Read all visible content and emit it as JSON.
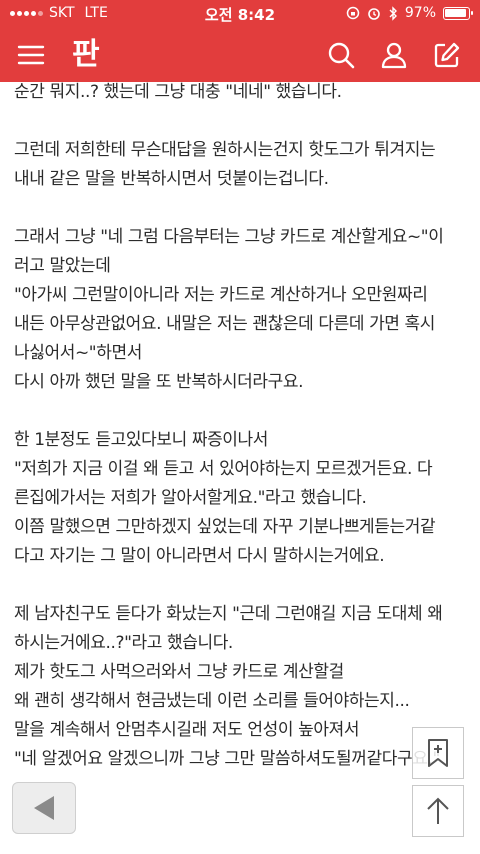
{
  "status_bar": {
    "carrier": "SKT",
    "network": "LTE",
    "time": "오전 8:42",
    "battery_pct": "97%"
  },
  "header": {
    "logo": "판",
    "icons": [
      "menu-icon",
      "search-icon",
      "user-icon",
      "edit-icon"
    ],
    "bg_color": "#e23d3d"
  },
  "article": {
    "paragraphs": [
      [
        "순간 뭐지..? 했는데 그냥 대충 \"네네\" 했습니다."
      ],
      [
        "그런데 저희한테 무슨대답을 원하시는건지 핫도그가 튀겨지는",
        "내내 같은 말을 반복하시면서 덧붙이는겁니다."
      ],
      [
        "그래서 그냥 \"네 그럼 다음부터는 그냥 카드로 계산할게요~\"이",
        "러고 말았는데",
        "\"아가씨 그런말이아니라 저는 카드로 계산하거나 오만원짜리",
        "내든 아무상관없어요. 내말은 저는 괜찮은데 다른데 가면 혹시",
        "나싫어서~\"하면서",
        "다시 아까 했던 말을 또 반복하시더라구요."
      ],
      [
        "한 1분정도 듣고있다보니 짜증이나서",
        "\"저희가 지금 이걸 왜 듣고 서 있어야하는지 모르겠거든요. 다",
        "른집에가서는 저희가 알아서할게요.\"라고 했습니다.",
        "이쯤 말했으면 그만하겠지 싶었는데 자꾸 기분나쁘게듣는거같",
        "다고 자기는 그 말이 아니라면서 다시 말하시는거에요."
      ],
      [
        "제 남자친구도 듣다가 화났는지 \"근데 그런얘길 지금 도대체 왜",
        "하시는거에요..?\"라고 했습니다.",
        "제가 핫도그 사먹으러와서 그냥 카드로 계산할걸",
        "왜 괜히 생각해서 현금냈는데 이런 소리를 들어야하는지...",
        "말을 계속해서 안멈추시길래 저도 언성이 높아져서",
        "\"네 알겠어요 알겠으니까 그냥 그만 말씀하셔도될꺼같다구요.\""
      ]
    ]
  }
}
